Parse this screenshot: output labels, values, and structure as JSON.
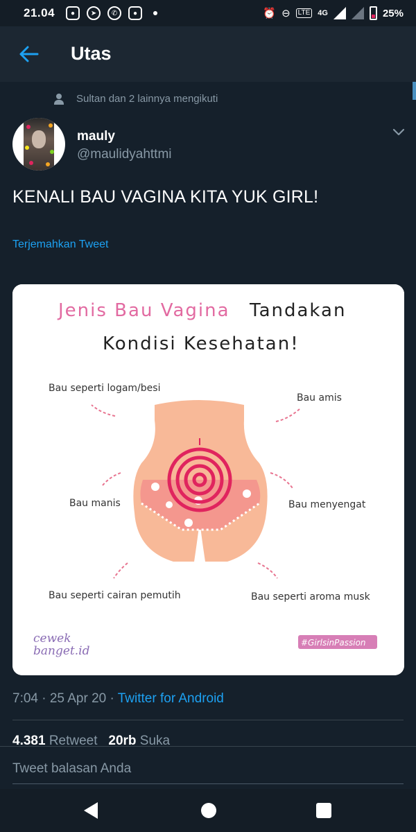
{
  "status_bar": {
    "time": "21.04",
    "network": "4G",
    "battery": "25%",
    "volte": "LTE"
  },
  "header": {
    "title": "Utas"
  },
  "tweet": {
    "social_context": "Sultan dan 2 lainnya mengikuti",
    "display_name": "mauly",
    "handle": "@maulidyahttmi",
    "text": "KENALI BAU VAGINA KITA YUK GIRL!",
    "translate": "Terjemahkan Tweet",
    "time_date": "7:04 · 25 Apr 20 · ",
    "source": "Twitter for Android",
    "retweet_count": "4.381",
    "retweet_label": "Retweet",
    "like_count": "20rb",
    "like_label": "Suka"
  },
  "image": {
    "title_pink": "Jenis Bau Vagina",
    "title_dark_1": "Tandakan",
    "title_dark_2": "Kondisi Kesehatan!",
    "labels": {
      "logam": "Bau seperti logam/besi",
      "amis": "Bau amis",
      "manis": "Bau manis",
      "menyengat": "Bau menyengat",
      "pemutih": "Bau seperti cairan pemutih",
      "musk": "Bau seperti aroma musk"
    },
    "brand_left_1": "cewek",
    "brand_left_2": "banget.id",
    "hashtag": "#GirlsinPassion"
  },
  "reply": {
    "placeholder": "Tweet balasan Anda"
  },
  "colors": {
    "accent": "#1da1f2",
    "background": "#15202b",
    "muted": "#8899a6",
    "pink": "#e26aa1"
  }
}
